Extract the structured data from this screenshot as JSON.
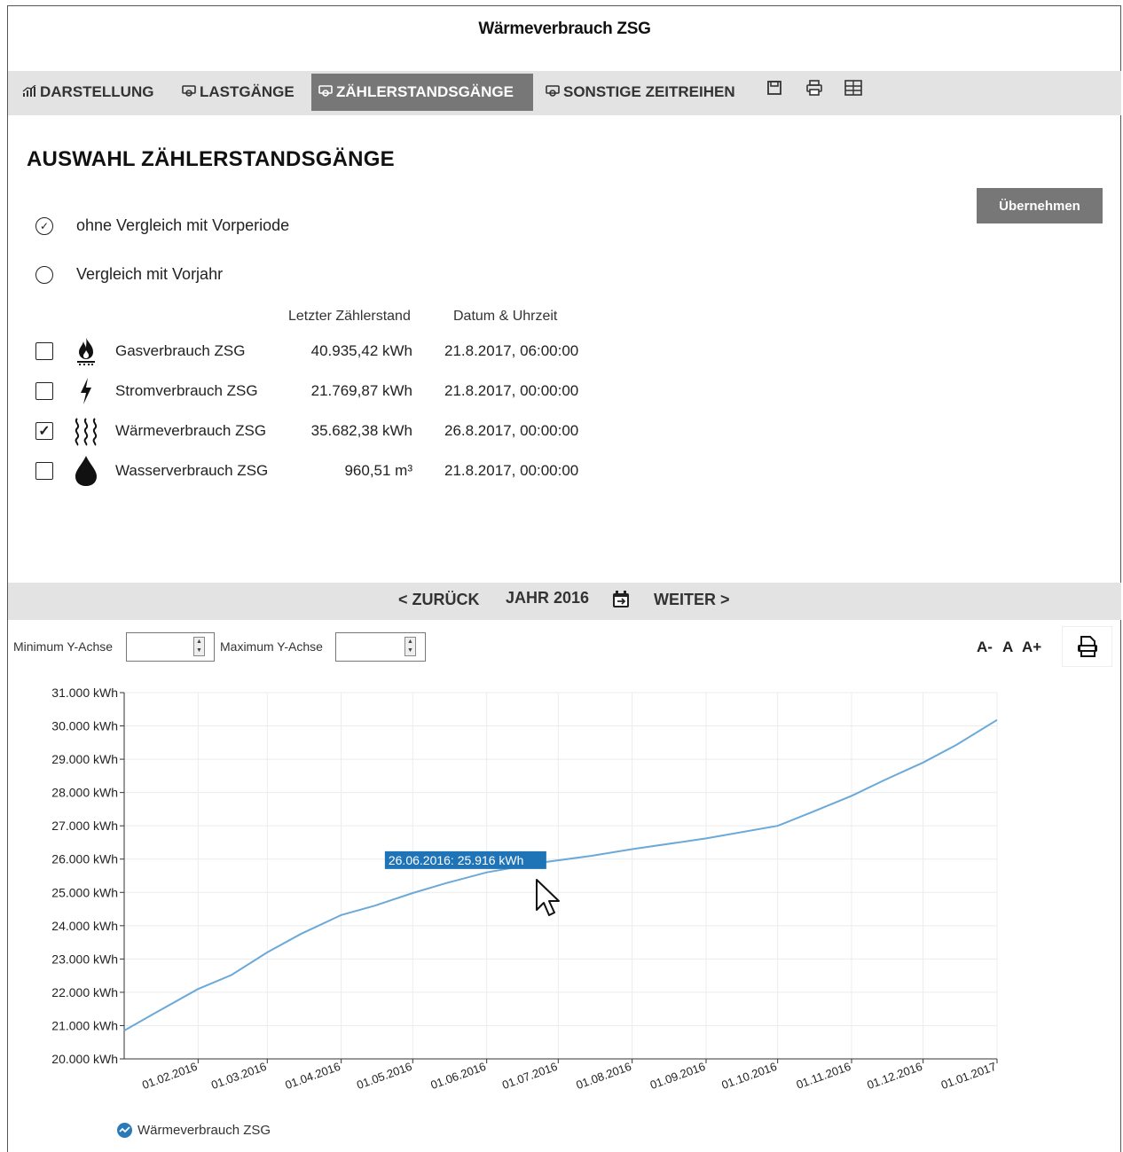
{
  "window": {
    "title": "Wärmeverbrauch ZSG"
  },
  "toolbar": {
    "tabs": [
      {
        "icon": "chart-icon",
        "label": "DARSTELLUNG",
        "active": false
      },
      {
        "icon": "meter-icon",
        "label": "LASTGÄNGE",
        "active": false
      },
      {
        "icon": "meter-icon",
        "label": "ZÄHLERSTANDSGÄNGE",
        "active": true
      },
      {
        "icon": "meter-icon",
        "label": "SONSTIGE ZEITREIHEN",
        "active": false
      }
    ],
    "tools": [
      "save-icon",
      "print-icon",
      "table-icon"
    ]
  },
  "section": {
    "title": "AUSWAHL ZÄHLERSTANDSGÄNGE",
    "apply_label": "Übernehmen",
    "options": [
      {
        "label": "ohne Vergleich mit Vorperiode",
        "selected": true
      },
      {
        "label": "Vergleich mit Vorjahr",
        "selected": false
      }
    ],
    "columns": {
      "last_reading": "Letzter Zählerstand",
      "datetime": "Datum & Uhrzeit"
    },
    "meters": [
      {
        "icon": "gas-flame-icon",
        "name": "Gasverbrauch ZSG",
        "value": "40.935,42 kWh",
        "date": "21.8.2017, 06:00:00",
        "checked": false
      },
      {
        "icon": "lightning-icon",
        "name": "Stromverbrauch ZSG",
        "value": "21.769,87 kWh",
        "date": "21.8.2017, 00:00:00",
        "checked": false
      },
      {
        "icon": "heat-waves-icon",
        "name": "Wärmeverbrauch ZSG",
        "value": "35.682,38 kWh",
        "date": "26.8.2017, 00:00:00",
        "checked": true
      },
      {
        "icon": "water-drop-icon",
        "name": "Wasserverbrauch ZSG",
        "value": "960,51 m³",
        "date": "21.8.2017, 00:00:00",
        "checked": false
      }
    ]
  },
  "period_nav": {
    "back": "ZURÜCK",
    "period": "JAHR 2016",
    "forward": "WEITER"
  },
  "axis_controls": {
    "min_label": "Minimum Y-Achse",
    "max_label": "Maximum Y-Achse",
    "min_value": "",
    "max_value": ""
  },
  "font_controls": [
    "A-",
    "A",
    "A+"
  ],
  "colors": {
    "accent": "#2a7ab9",
    "line": "#6ba9d8",
    "bar": "#e3e3e3",
    "active_tab": "#777777"
  },
  "chart_data": {
    "type": "line",
    "ylim": [
      20000,
      31000
    ],
    "yticks": [
      "20.000 kWh",
      "21.000 kWh",
      "22.000 kWh",
      "23.000 kWh",
      "24.000 kWh",
      "25.000 kWh",
      "26.000 kWh",
      "27.000 kWh",
      "28.000 kWh",
      "29.000 kWh",
      "30.000 kWh",
      "31.000 kWh"
    ],
    "xticks": [
      "01.02.2016",
      "01.03.2016",
      "01.04.2016",
      "01.05.2016",
      "01.06.2016",
      "01.07.2016",
      "01.08.2016",
      "01.09.2016",
      "01.10.2016",
      "01.11.2016",
      "01.12.2016",
      "01.01.2017"
    ],
    "grid": true,
    "series": [
      {
        "name": "Wärmeverbrauch ZSG",
        "x": [
          "01.01.2016",
          "15.01.2016",
          "01.02.2016",
          "15.02.2016",
          "01.03.2016",
          "15.03.2016",
          "01.04.2016",
          "15.04.2016",
          "01.05.2016",
          "15.05.2016",
          "01.06.2016",
          "26.06.2016",
          "15.07.2016",
          "01.08.2016",
          "01.09.2016",
          "01.10.2016",
          "15.10.2016",
          "01.11.2016",
          "15.11.2016",
          "01.12.2016",
          "15.12.2016",
          "01.01.2017"
        ],
        "values": [
          20850,
          21420,
          22100,
          22520,
          23200,
          23750,
          24320,
          24600,
          24980,
          25280,
          25600,
          25916,
          26100,
          26300,
          26620,
          27000,
          27400,
          27900,
          28380,
          28900,
          29430,
          30180
        ]
      }
    ],
    "tooltip": "26.06.2016: 25.916 kWh",
    "legend": "bottom-left"
  }
}
